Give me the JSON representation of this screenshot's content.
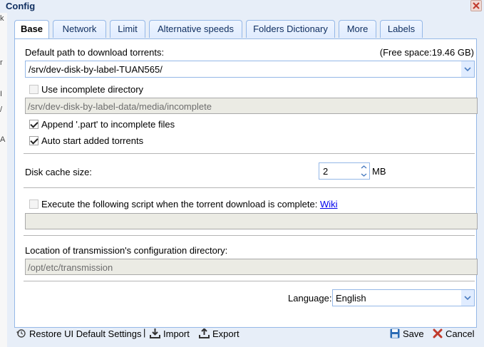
{
  "window": {
    "title": "Config"
  },
  "left_strip": [
    "k",
    "r",
    "I",
    "/",
    "A"
  ],
  "tabs": [
    {
      "label": "Base",
      "active": true
    },
    {
      "label": "Network"
    },
    {
      "label": "Limit"
    },
    {
      "label": "Alternative speeds"
    },
    {
      "label": "Folders Dictionary"
    },
    {
      "label": "More"
    },
    {
      "label": "Labels"
    }
  ],
  "base": {
    "download_path_label": "Default path to download torrents:",
    "free_space": "(Free space:19.46 GB)",
    "download_path_value": "/srv/dev-disk-by-label-TUAN565/",
    "use_incomplete_label": "Use incomplete directory",
    "use_incomplete_checked": false,
    "incomplete_path_value": "/srv/dev-disk-by-label-data/media/incomplete",
    "append_part_label": "Append '.part' to incomplete files",
    "append_part_checked": true,
    "auto_start_label": "Auto start added torrents",
    "auto_start_checked": true,
    "disk_cache_label": "Disk cache size:",
    "disk_cache_value": "2",
    "disk_cache_unit": "MB",
    "script_label": "Execute the following script when the torrent download is complete:",
    "script_link": "Wiki",
    "script_checked": false,
    "script_value": "",
    "config_dir_label": "Location of transmission's configuration directory:",
    "config_dir_value": "/opt/etc/transmission",
    "language_label": "Language:",
    "language_value": "English"
  },
  "footer": {
    "restore_label": "Restore UI Default Settings",
    "separator": "|",
    "import_label": "Import",
    "export_label": "Export",
    "save_label": "Save",
    "cancel_label": "Cancel"
  },
  "colors": {
    "accent_border": "#95b8e7",
    "panel_bg": "#e7eef8",
    "close_red": "#c0392b",
    "save_blue": "#2a6bb5",
    "link": "#0000ee"
  }
}
